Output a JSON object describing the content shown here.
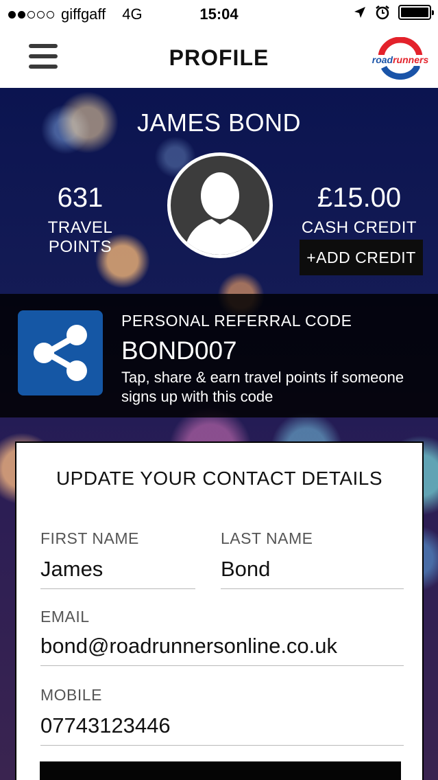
{
  "status_bar": {
    "carrier": "giffgaff",
    "network": "4G",
    "time": "15:04"
  },
  "nav": {
    "title": "PROFILE",
    "logo_text": "roadrunners"
  },
  "profile": {
    "name": "JAMES BOND",
    "travel_points": "631",
    "travel_points_label": "TRAVEL POINTS",
    "cash_credit": "£15.00",
    "cash_credit_label": "CASH CREDIT",
    "add_credit_label": "+ADD CREDIT"
  },
  "referral": {
    "label": "PERSONAL REFERRAL CODE",
    "code": "BOND007",
    "description": "Tap, share & earn travel points if someone signs up with this code"
  },
  "contact_form": {
    "title": "UPDATE YOUR CONTACT DETAILS",
    "first_name_label": "FIRST NAME",
    "first_name_value": "James",
    "last_name_label": "LAST NAME",
    "last_name_value": "Bond",
    "email_label": "EMAIL",
    "email_value": "bond@roadrunnersonline.co.uk",
    "mobile_label": "MOBILE",
    "mobile_value": "07743123446"
  },
  "colors": {
    "share_button": "#1557a5",
    "logo_red": "#e3222b",
    "logo_blue": "#1a54a8"
  }
}
